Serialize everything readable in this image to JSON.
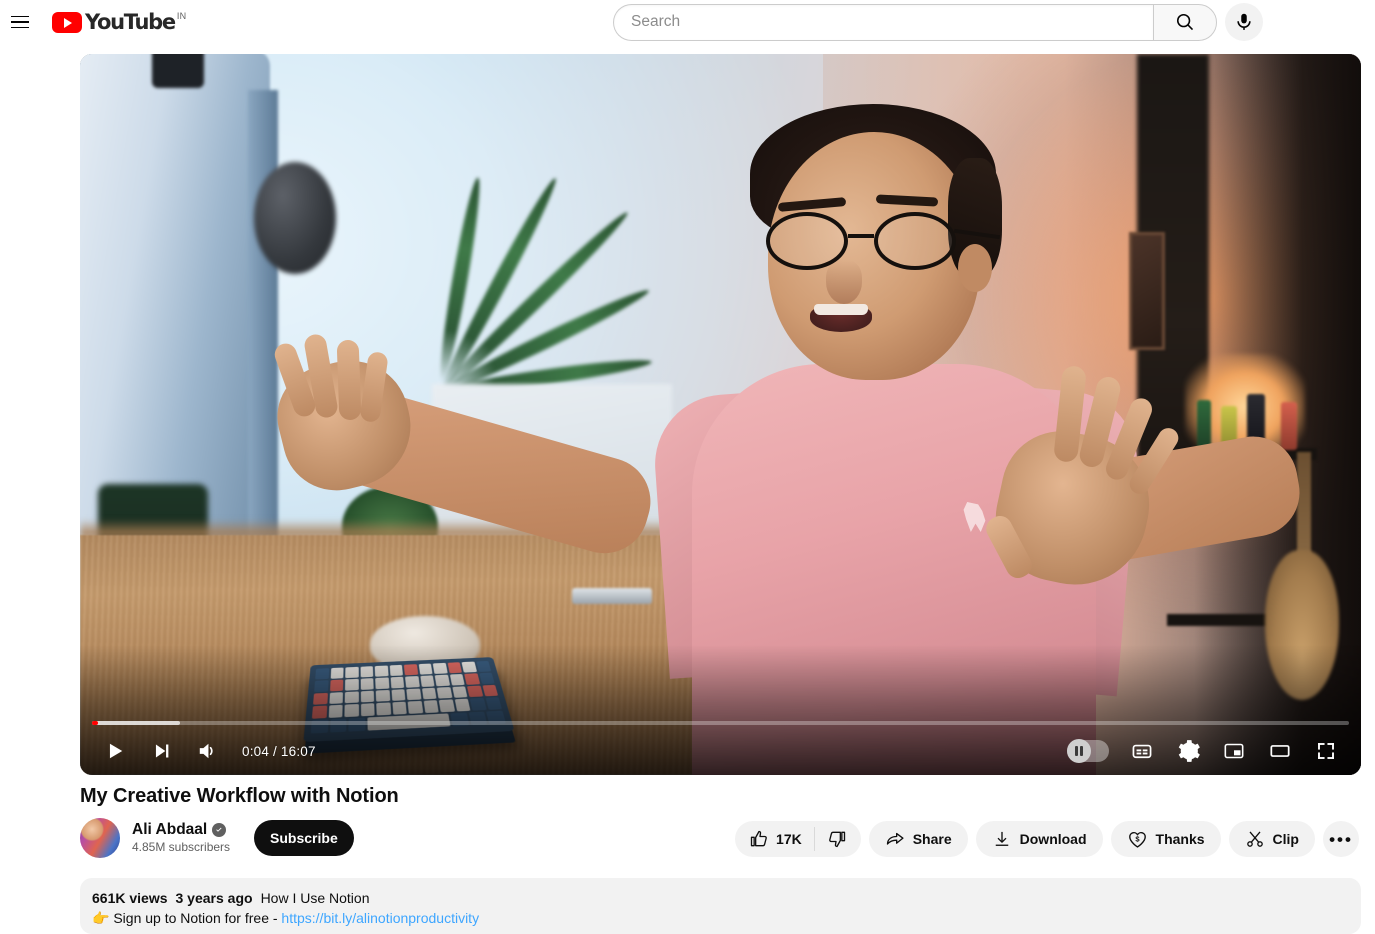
{
  "header": {
    "menu_icon": "hamburger-menu-icon",
    "logo_text": "YouTube",
    "country_code": "IN",
    "search": {
      "value": "",
      "placeholder": "Search",
      "submit_icon": "search-icon"
    },
    "voice_search_icon": "microphone-icon"
  },
  "player": {
    "play_icon": "play-icon",
    "next_icon": "next-track-icon",
    "volume_icon": "volume-icon",
    "time_display": "0:04 / 16:07",
    "current_time": "0:04",
    "duration": "16:07",
    "progress_percent": 0.45,
    "buffered_percent": 7,
    "autoplay_icon": "autoplay-toggle",
    "autoplay_on": false,
    "captions_icon": "closed-captions-icon",
    "settings_icon": "settings-gear-icon",
    "miniplayer_icon": "miniplayer-icon",
    "theater_icon": "theater-mode-icon",
    "fullscreen_icon": "fullscreen-icon",
    "progress_color": "#ff0000"
  },
  "video": {
    "title": "My Creative Workflow with Notion",
    "channel": {
      "name": "Ali Abdaal",
      "verified_icon": "verified-badge-icon",
      "subscribers": "4.85M subscribers",
      "avatar": "channel-avatar"
    },
    "subscribe_label": "Subscribe"
  },
  "actions": {
    "like_icon": "thumbs-up-icon",
    "like_count": "17K",
    "dislike_icon": "thumbs-down-icon",
    "share_icon": "share-arrow-icon",
    "share_label": "Share",
    "download_icon": "download-icon",
    "download_label": "Download",
    "thanks_icon": "thanks-heart-dollar-icon",
    "thanks_label": "Thanks",
    "clip_icon": "scissors-clip-icon",
    "clip_label": "Clip",
    "more_icon": "more-actions-icon",
    "more_label": "•••"
  },
  "description": {
    "views": "661K views",
    "published": "3 years ago",
    "hashtag": "How I Use Notion",
    "emoji": "👉",
    "body_text": "Sign up to Notion for free - ",
    "link_text": "https://bit.ly/alinotionproductivity",
    "link_color": "#3ea6ff"
  }
}
